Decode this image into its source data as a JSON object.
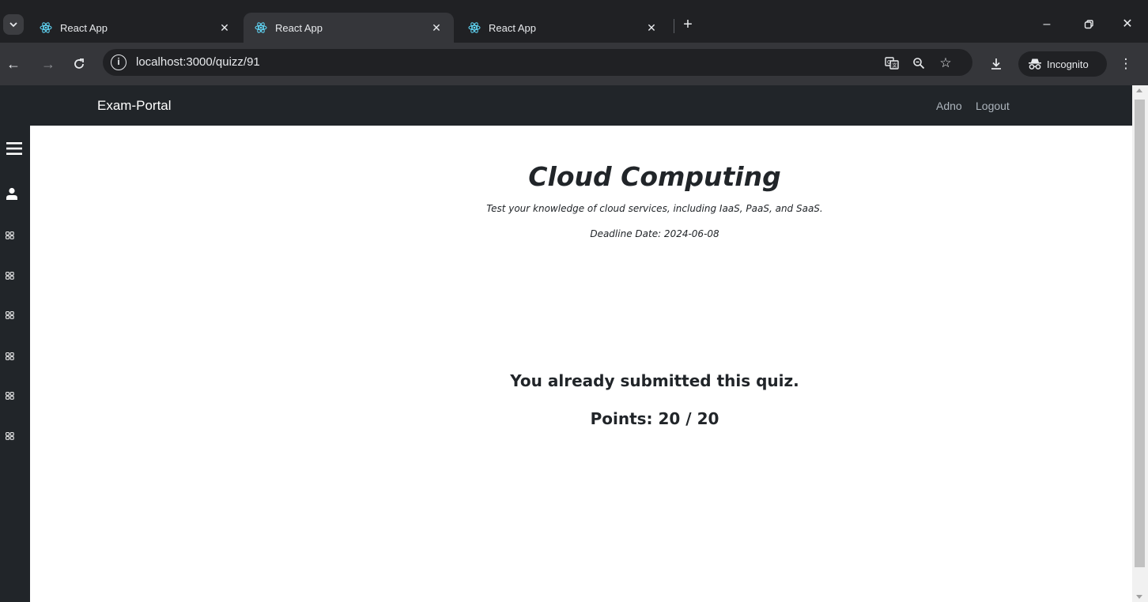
{
  "browser": {
    "tabs": [
      {
        "title": "React App",
        "active": false
      },
      {
        "title": "React App",
        "active": true
      },
      {
        "title": "React App",
        "active": false
      }
    ],
    "url": "localhost:3000/quizz/91",
    "incognito_label": "Incognito",
    "colors": {
      "frame": "#202124",
      "toolbar": "#35363a",
      "react_blue": "#61dafb"
    }
  },
  "navbar": {
    "brand": "Exam-Portal",
    "user": "Adno",
    "logout": "Logout"
  },
  "sidebar": {
    "icons": [
      "menu-icon",
      "user-icon",
      "grid-icon",
      "grid-icon",
      "grid-icon",
      "grid-icon",
      "grid-icon",
      "grid-icon"
    ]
  },
  "quiz": {
    "title": "Cloud Computing",
    "description": "Test your knowledge of cloud services, including IaaS, PaaS, and SaaS.",
    "deadline": "Deadline Date: 2024-06-08",
    "status": "You already submitted this quiz.",
    "points": "Points: 20 / 20"
  }
}
